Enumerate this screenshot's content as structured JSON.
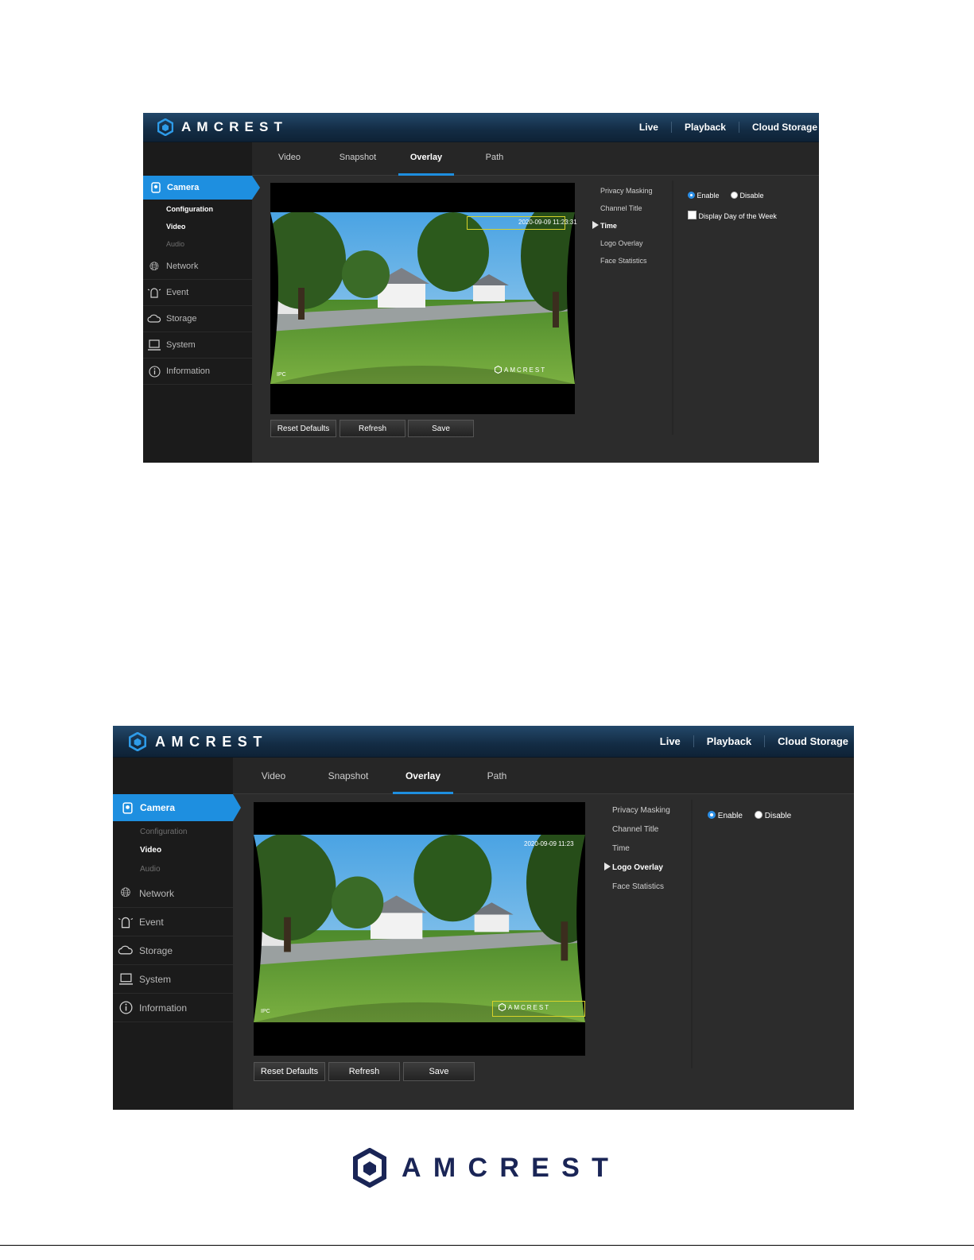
{
  "brand": {
    "name": "AMCREST"
  },
  "top_nav": [
    "Live",
    "Playback",
    "Cloud Storage"
  ],
  "tabs": [
    "Video",
    "Snapshot",
    "Overlay",
    "Path"
  ],
  "sidebar": {
    "camera": "Camera",
    "sub_items": [
      "Configuration",
      "Video",
      "Audio"
    ],
    "items": [
      "Network",
      "Event",
      "Storage",
      "System",
      "Information"
    ]
  },
  "overlay_menu": [
    "Privacy Masking",
    "Channel Title",
    "Time",
    "Logo Overlay",
    "Face Statistics"
  ],
  "buttons": {
    "reset": "Reset Defaults",
    "refresh": "Refresh",
    "save": "Save"
  },
  "options": {
    "enable": "Enable",
    "disable": "Disable",
    "day_of_week": "Display Day of the Week"
  },
  "video": {
    "osd_logo": "AMCREST",
    "channel_label": "IPC"
  },
  "screens": [
    {
      "active_tab": "Overlay",
      "active_sub": "Video",
      "active_menu": "Time",
      "radio": "Enable",
      "show_day_of_week": true,
      "day_of_week_checked": false,
      "osd_time": "2020-09-09 11:23:31"
    },
    {
      "active_tab": "Overlay",
      "active_sub": "Video",
      "active_menu": "Logo Overlay",
      "radio": "Enable",
      "show_day_of_week": false,
      "osd_time": "2020-09-09 11:23"
    }
  ],
  "colors": {
    "accent": "#1e8fe0",
    "footer_logo": "#1a2556",
    "osd_box": "#d7d22a"
  }
}
